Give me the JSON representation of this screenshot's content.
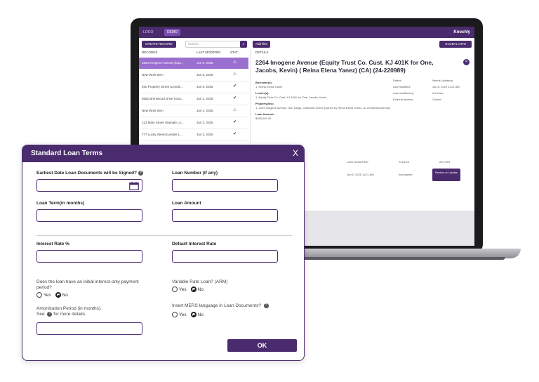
{
  "app": {
    "logo_text": "LOGO",
    "demo_badge": "DEMO",
    "user_name": "Knochly",
    "create_record": "CREATE RECORD",
    "search_placeholder": "Search...",
    "add_files": "Add files",
    "global_info": "GLOBAL INFO",
    "records_header": "RECORDS",
    "last_modified_header": "LAST MODIFIED",
    "status_header": "STAT...",
    "details_header": "DETAILS",
    "records": [
      {
        "name": "2264 Imogene Avenue (Equ...",
        "date": "Jun 6, 2025",
        "status": "⚠"
      },
      {
        "name": "New Work Item",
        "date": "Jun 5, 2025",
        "status": "⚠"
      },
      {
        "name": "400 Property Street (Lendin...",
        "date": "Jun 5, 2025",
        "status": "✔"
      },
      {
        "name": "5652 Brentwood Drive (Gou...",
        "date": "Jun 4, 2025",
        "status": "✔"
      },
      {
        "name": "New Work Item",
        "date": "Jun 4, 2025",
        "status": "⚠"
      },
      {
        "name": "123 Main Street (Sample Lo...",
        "date": "Jun 3, 2025",
        "status": "✔"
      },
      {
        "name": "777 Lucky Street (Lender L...",
        "date": "Jun 3, 2025",
        "status": "✔"
      }
    ],
    "detail": {
      "title": "2264 Imogene Avenue (Equity Trust Co. Cust. KJ 401K for One, Jacobs, Kevin) ( Reina Elena Yanez) (CA) (24-220989)",
      "borrowers_label": "Borrower(s):",
      "borrowers_value": "1. Reina Elena Yanez",
      "lenders_label": "Lender(s):",
      "lenders_value": "1. Equity Trust Co. Cust. KJ 401K for One, Jacobs, Kevin",
      "property_label": "Property(ies):",
      "property_value": "1. 2264 Imogene Avenue, San Diego, California 92154 (owned by Reina Elena Yanez, an unmarried woman)",
      "loan_amount_label": "Loan Amount:",
      "loan_amount_value": "$380,000.00",
      "status_label": "Status:",
      "status_value": "Needs Updating",
      "last_modified_label": "Last modified:",
      "last_modified_value": "Jun 6, 2025 11:21 AM",
      "last_modified_by_label": "Last modified by:",
      "last_modified_by_value": "Kai Hara",
      "external_access_label": "External access:",
      "external_access_value": "Closed"
    },
    "table": {
      "col_last_modified": "LAST MODIFIED",
      "col_status": "STATUS",
      "col_action": "ACTION",
      "row_date": "Jun 6, 2025 11:21 AM",
      "row_status": "Incomplete",
      "row_action": "Review or Update"
    }
  },
  "modal": {
    "title": "Standard Loan Terms",
    "close": "X",
    "earliest_date_label": "Earliest Date Loan Documents will be Signed?",
    "loan_number_label": "Loan Number (if any)",
    "loan_term_label": "Loan Term(in months)",
    "loan_amount_label": "Loan Amount",
    "interest_rate_label": "Interest Rate %",
    "default_interest_label": "Default Interest Rate",
    "interest_only_label": "Does the loan have an initial interest-only payment period?",
    "variable_rate_label": "Variable Rate Loan? (ARM)",
    "amortization_label_1": "Amortization Period (in months).",
    "amortization_label_2": "See",
    "amortization_label_3": "for more details.",
    "mers_label": "Insert MERS language in Loan Documents?",
    "yes": "Yes",
    "no": "No",
    "ok": "OK"
  }
}
